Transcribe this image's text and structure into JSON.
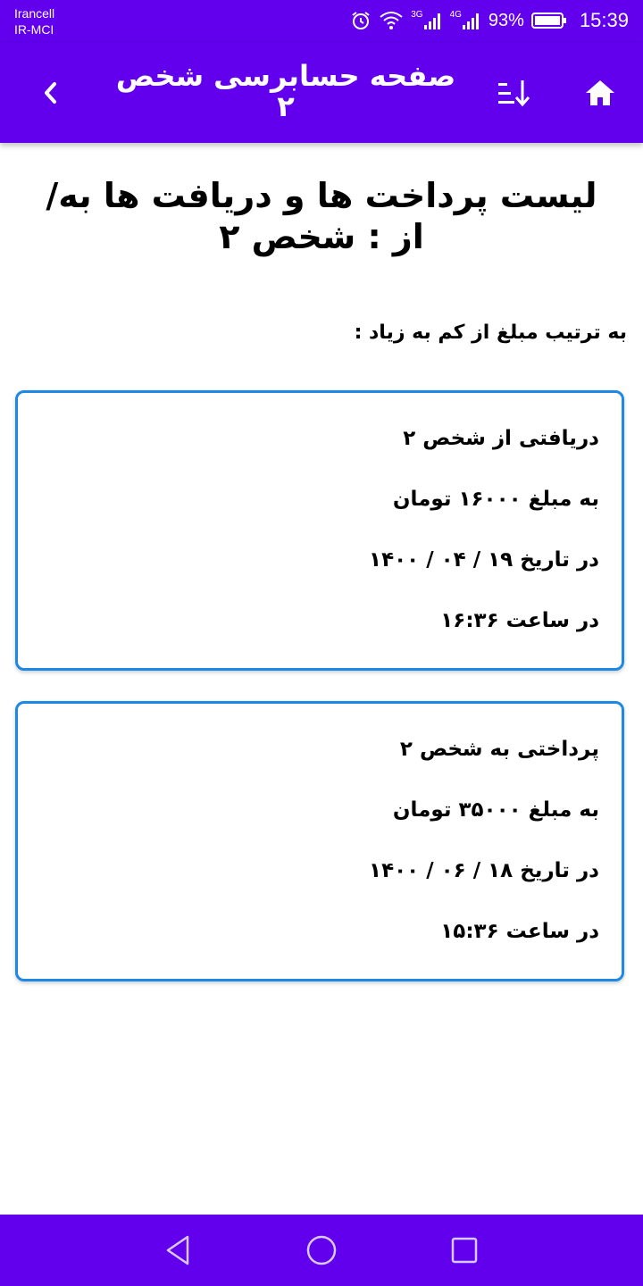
{
  "status_bar": {
    "carrier_line1": "Irancell",
    "carrier_line2": "IR-MCI",
    "network_1": "3G",
    "network_2": "4G",
    "battery": "93%",
    "time": "15:39",
    "icons": [
      "alarm-icon",
      "wifi-icon",
      "signal-icon",
      "battery-icon"
    ]
  },
  "app_bar": {
    "title": "صفحه حسابرسی شخص ۲",
    "back_icon": "chevron-left-icon",
    "sort_icon": "sort-icon",
    "home_icon": "home-icon",
    "color": "#6200ee"
  },
  "main": {
    "title": "لیست پرداخت ها و دریافت ها به/از : شخص ۲",
    "sort_label": "به ترتیب مبلغ از کم به زیاد :",
    "card_border_color": "#1e88e5",
    "cards": [
      {
        "line1": "دریافتی از شخص ۲",
        "line2": "به مبلغ ۱۶۰۰۰ تومان",
        "line3": "در تاریخ ۱۹ / ۰۴ / ۱۴۰۰",
        "line4": "در ساعت ۱۶:۳۶"
      },
      {
        "line1": "پرداختی به شخص ۲",
        "line2": "به مبلغ ۳۵۰۰۰ تومان",
        "line3": "در تاریخ ۱۸ / ۰۶ / ۱۴۰۰",
        "line4": "در ساعت ۱۵:۳۶"
      }
    ]
  },
  "nav_bar": {
    "icons": [
      "nav-back-icon",
      "nav-home-icon",
      "nav-recent-icon"
    ]
  }
}
